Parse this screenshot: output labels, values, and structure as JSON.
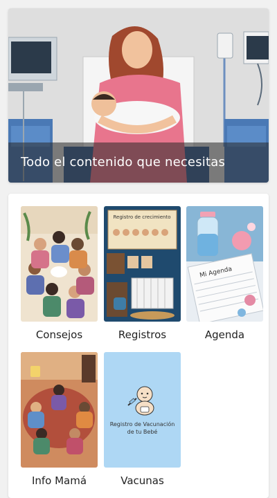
{
  "hero": {
    "caption": "Todo el contenido que necesitas"
  },
  "tiles": [
    {
      "label": "Consejos",
      "image_text": ""
    },
    {
      "label": "Registros",
      "image_text": "Registro de crecimiento"
    },
    {
      "label": "Agenda",
      "image_text": "Mi Agenda"
    },
    {
      "label": "Info Mamá",
      "image_text": ""
    },
    {
      "label": "Vacunas",
      "image_text": "Registro de Vacunación de tu Bebé"
    }
  ],
  "colors": {
    "background": "#f1f1f1",
    "caption_overlay": "#282828",
    "vaccine_tile_bg": "#aed7f4"
  }
}
